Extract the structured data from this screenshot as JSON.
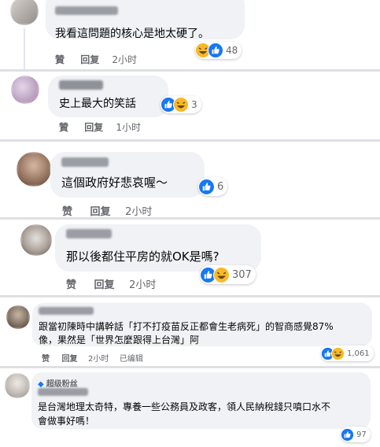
{
  "comments": [
    {
      "text": "我看這問題的核心是地太硬了。",
      "actions": {
        "like": "贊",
        "reply": "回复",
        "time": "2小时"
      },
      "reactions": {
        "icons": [
          "haha-icon",
          "like-icon"
        ],
        "count": "48"
      }
    },
    {
      "text": "史上最大的笑話",
      "actions": {
        "like": "贊",
        "reply": "回复",
        "time": "1小时"
      },
      "reactions": {
        "icons": [
          "like-icon",
          "haha-icon"
        ],
        "count": "3"
      }
    },
    {
      "text": "這個政府好悲哀喔～",
      "actions": {
        "like": "赞",
        "reply": "回复",
        "time": "2小时"
      },
      "reactions": {
        "icons": [
          "like-icon"
        ],
        "count": "6"
      }
    },
    {
      "text": "那以後都住平房的就OK是嗎?",
      "actions": {
        "like": "赞",
        "reply": "回复",
        "time": "2小时"
      },
      "reactions": {
        "icons": [
          "like-icon",
          "haha-icon"
        ],
        "count": "307"
      }
    },
    {
      "text_lines": [
        "跟當初陳時中講幹話「打不打疫苗反正都會生老病死」的智商感覺87%",
        "像，果然是「世界怎麼跟得上台灣」阿"
      ],
      "actions": {
        "like": "赞",
        "reply": "回复",
        "time": "2小时",
        "edited": "已编辑"
      },
      "reactions": {
        "icons": [
          "like-icon",
          "haha-icon"
        ],
        "count": "1,061"
      }
    },
    {
      "badge": "超级粉丝",
      "text_lines": [
        "是台灣地理太奇特，專養一些公務員及政客，領人民納稅錢只噴口水不",
        "會做事好嗎！"
      ],
      "reactions": {
        "icons": [
          "like-icon"
        ],
        "count": "97"
      }
    }
  ],
  "colors": {
    "like_blue": "#1877f2",
    "haha_yellow": "#f7b928",
    "bubble": "#f0f2f5",
    "meta_gray": "#65676b"
  }
}
